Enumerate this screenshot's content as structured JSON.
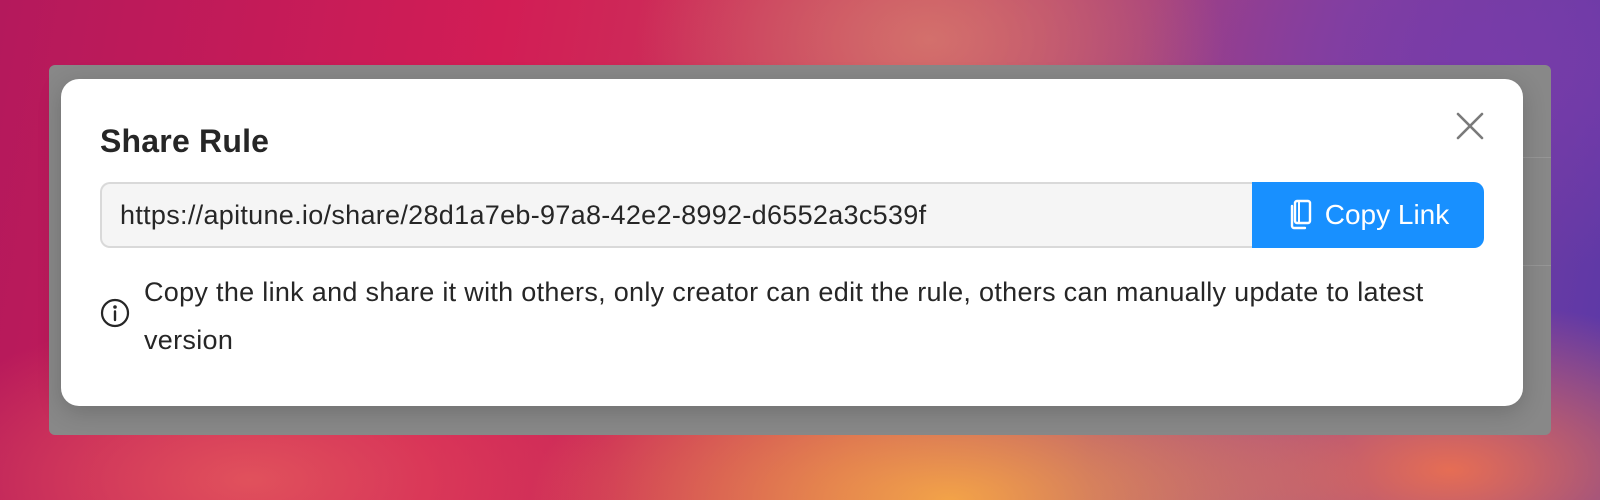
{
  "modal": {
    "title": "Share Rule",
    "close_icon": "close-icon",
    "share_url": "https://apitune.io/share/28d1a7eb-97a8-42e2-8992-d6552a3c539f",
    "copy_button": {
      "label": "Copy Link",
      "icon": "copy-icon",
      "color": "#1890ff"
    },
    "info": {
      "icon": "info-circle-icon",
      "text": "Copy the link and share it with others, only creator can edit the rule, others can manually update to latest version"
    }
  }
}
